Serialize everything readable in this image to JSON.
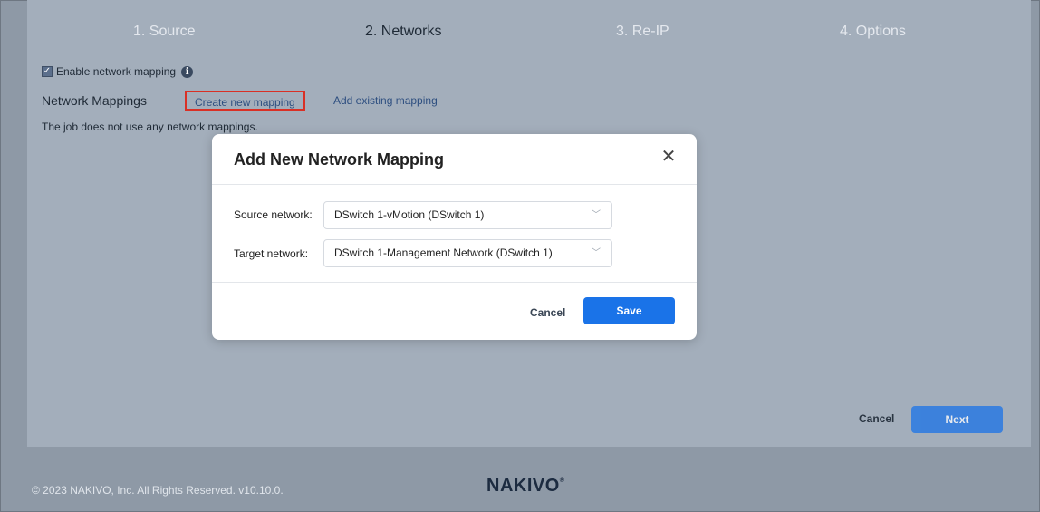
{
  "wizard": {
    "steps": [
      "1. Source",
      "2. Networks",
      "3. Re-IP",
      "4. Options"
    ],
    "active_step": "2. Networks"
  },
  "networks": {
    "enable_label": "Enable network mapping",
    "enable_checked": true,
    "mappings_title": "Network Mappings",
    "create_link": "Create new mapping",
    "add_link": "Add existing mapping",
    "empty_text": "The job does not use any network mappings."
  },
  "footer_buttons": {
    "cancel": "Cancel",
    "next": "Next"
  },
  "page_footer": {
    "copyright": "© 2023 NAKIVO, Inc. All Rights Reserved. v10.10.0.",
    "logo": "NAKIVO",
    "logo_mark": "®"
  },
  "modal": {
    "title": "Add New Network Mapping",
    "close_icon": "close-icon",
    "source_label": "Source network:",
    "source_value": "DSwitch 1-vMotion (DSwitch 1)",
    "target_label": "Target network:",
    "target_value": "DSwitch 1-Management Network (DSwitch 1)",
    "cancel": "Cancel",
    "save": "Save"
  },
  "colors": {
    "primary": "#1a73e8",
    "link": "#2e4f80",
    "highlight": "#d93025",
    "overlay": "#8e99a6"
  }
}
